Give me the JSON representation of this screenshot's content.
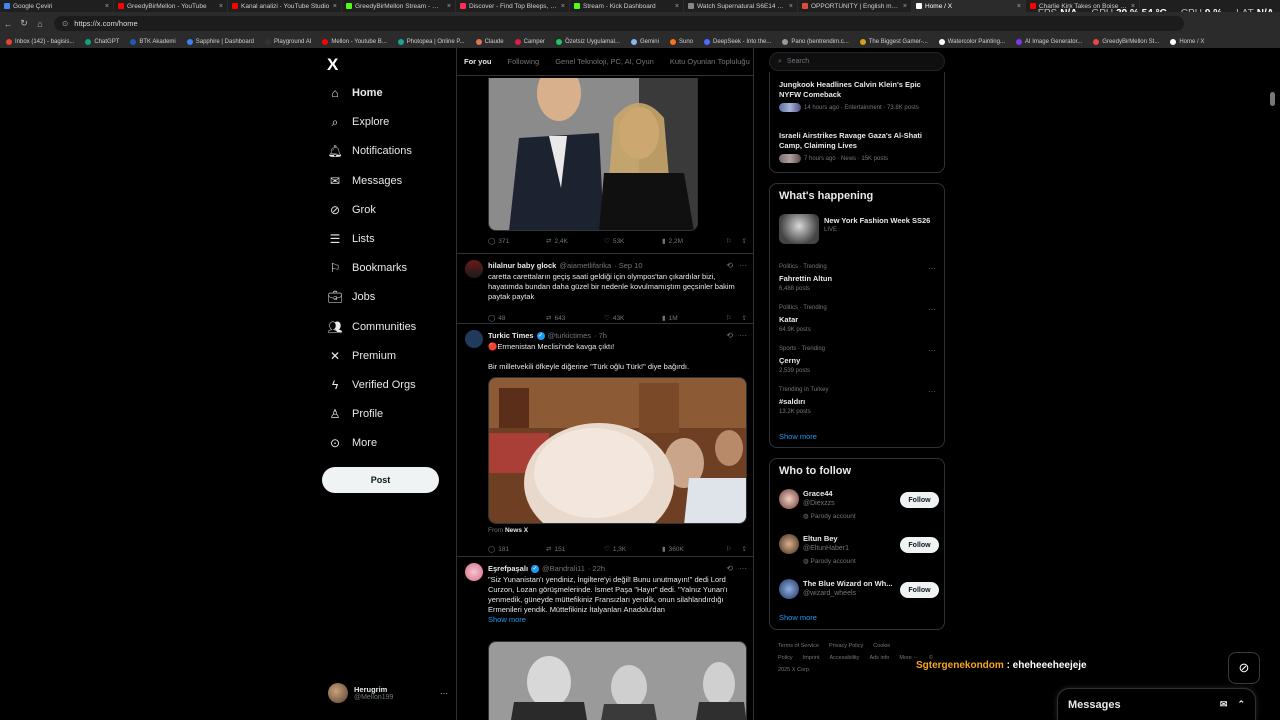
{
  "browser": {
    "tabs": [
      {
        "label": "Google Çeviri",
        "color": "#4285f4"
      },
      {
        "label": "GreedyBirMellon - YouTube",
        "color": "#ff0000"
      },
      {
        "label": "Kanal analizi - YouTube Studio",
        "color": "#ff0000"
      },
      {
        "label": "GreedyBirMellon Stream - Watc",
        "color": "#53fc18"
      },
      {
        "label": "Discover - Find Top Bleeps, Stre",
        "color": "#ff2d55"
      },
      {
        "label": "Stream - Kick Dashboard",
        "color": "#53fc18"
      },
      {
        "label": "Watch Supernatural S6E14 onlin",
        "color": "#888888"
      },
      {
        "label": "OPPORTUNITY | English meanin",
        "color": "#e04a3a"
      },
      {
        "label": "Home / X",
        "color": "#ffffff"
      },
      {
        "label": "Charlie Kirk Takes on Boise Stat",
        "color": "#ff0000"
      }
    ],
    "url": "https://x.com/home",
    "bookmarks": [
      {
        "label": "Inbox (142) - bagisis...",
        "color": "#ea4335"
      },
      {
        "label": "ChatGPT",
        "color": "#10a37f"
      },
      {
        "label": "BTK Akademi",
        "color": "#1e5bb8"
      },
      {
        "label": "Sapphire | Dashboard",
        "color": "#3b82f6"
      },
      {
        "label": "Playground AI",
        "color": "#333333"
      },
      {
        "label": "Mellon - Youtube B...",
        "color": "#ff0000"
      },
      {
        "label": "Photopea | Online P...",
        "color": "#18a497"
      },
      {
        "label": "Claude",
        "color": "#d97757"
      },
      {
        "label": "Camper",
        "color": "#e11d48"
      },
      {
        "label": "Özetsiz Uygulamal...",
        "color": "#22c55e"
      },
      {
        "label": "Gemini",
        "color": "#8ab4f8"
      },
      {
        "label": "Suno",
        "color": "#f97316"
      },
      {
        "label": "DeepSeek - Into the...",
        "color": "#4d6bfe"
      },
      {
        "label": "Pano (bentrendim.c...",
        "color": "#999999"
      },
      {
        "label": "The Biggest Gamer-...",
        "color": "#d4a017"
      },
      {
        "label": "Watercolor Painting...",
        "color": "#ffffff"
      },
      {
        "label": "AI Image Generator...",
        "color": "#7c3aed"
      },
      {
        "label": "GreedyBirMellon St...",
        "color": "#ef4444"
      },
      {
        "label": "Home / X",
        "color": "#ffffff"
      }
    ],
    "overlay": {
      "fps_label": "FPS",
      "fps": "N/A",
      "gpu_label": "GPU",
      "gpu": "39 %  54 °C",
      "cpu_label": "CPU",
      "cpu": "9 %",
      "lat_label": "LAT",
      "lat": "N/A"
    }
  },
  "nav": {
    "logo": "X",
    "items": [
      {
        "label": "Home",
        "icon": "home-icon"
      },
      {
        "label": "Explore",
        "icon": "search-icon"
      },
      {
        "label": "Notifications",
        "icon": "bell-icon"
      },
      {
        "label": "Messages",
        "icon": "envelope-icon"
      },
      {
        "label": "Grok",
        "icon": "grok-icon"
      },
      {
        "label": "Lists",
        "icon": "list-icon"
      },
      {
        "label": "Bookmarks",
        "icon": "bookmark-icon"
      },
      {
        "label": "Jobs",
        "icon": "briefcase-icon"
      },
      {
        "label": "Communities",
        "icon": "people-icon"
      },
      {
        "label": "Premium",
        "icon": "x-icon"
      },
      {
        "label": "Verified Orgs",
        "icon": "lightning-icon"
      },
      {
        "label": "Profile",
        "icon": "person-icon"
      },
      {
        "label": "More",
        "icon": "more-circle-icon"
      }
    ],
    "post_label": "Post",
    "account": {
      "name": "Herugrim",
      "handle": "@Mellon199",
      "more": "···"
    }
  },
  "feed": {
    "tabs": [
      "For you",
      "Following",
      "Genel Teknoloji, PC, AI, Oyun",
      "Kutu Oyunları Topluluğu"
    ],
    "posts": [
      {
        "stats": {
          "replies": "371",
          "reposts": "2,4K",
          "likes": "53K",
          "views": "2,2M"
        }
      },
      {
        "name": "hilalnur baby glock",
        "handle": "@aiametlifarika",
        "time": "· Sep 10",
        "text": "caretta carettaların geçiş saati geldiği için olympos'tan çıkardılar bizi, hayatımda bundan daha güzel bir nedenle kovulmamıştım geçsinler bakim paytak paytak",
        "stats": {
          "replies": "48",
          "reposts": "643",
          "likes": "43K",
          "views": "1M"
        }
      },
      {
        "name": "Turkic Times",
        "handle": "@turkictimes",
        "time": "· 7h",
        "line1": "🔴Ermenistan Meclisi'nde kavga çıktı!",
        "line2": "Bir milletvekili öfkeyle diğerine \"Türk oğlu Türk!\" diye bağırdı.",
        "from_label": "From",
        "from_source": "News X",
        "stats": {
          "replies": "181",
          "reposts": "151",
          "likes": "1,3K",
          "views": "360K"
        }
      },
      {
        "name": "Eşrefpaşalı",
        "handle": "@Bandrali11",
        "time": "· 22h",
        "text": "\"Siz Yunanistan'ı yendiniz, İngiltere'yi değil! Bunu unutmayın!\" dedi Lord Curzon, Lozan görüşmelerinde. İsmet Paşa \"Hayır\" dedi. \"Yalnız Yunan'ı yenmedik, güneyde müttefikiniz Fransızları yendik, onun silahlandırdığı Ermenileri yendik. Müttefikiniz İtalyanları Anadolu'dan",
        "show_more": "Show more"
      }
    ]
  },
  "right": {
    "search_placeholder": "Search",
    "news": [
      {
        "title": "Jungkook Headlines Calvin Klein's Epic NYFW Comeback",
        "meta": "14 hours ago · Entertainment · 73.8K posts"
      },
      {
        "title": "Israeli Airstrikes Ravage Gaza's Al-Shati Camp, Claiming Lives",
        "meta": "7 hours ago · News · 15K posts"
      }
    ],
    "happening": {
      "title": "What's happening",
      "event": {
        "name": "New York Fashion Week SS26",
        "status": "LIVE"
      },
      "trends": [
        {
          "meta": "Politics · Trending",
          "name": "Fahrettin Altun",
          "posts": "6,488 posts"
        },
        {
          "meta": "Politics · Trending",
          "name": "Katar",
          "posts": "64.9K posts"
        },
        {
          "meta": "Sports · Trending",
          "name": "Çerny",
          "posts": "2,539 posts"
        },
        {
          "meta": "Trending in Turkey",
          "name": "#saldırı",
          "posts": "13.2K posts"
        }
      ],
      "show_more": "Show more"
    },
    "who_to_follow": {
      "title": "Who to follow",
      "users": [
        {
          "name": "Grace44",
          "handle": "@Diexzzs",
          "note": "Parody account",
          "button": "Follow"
        },
        {
          "name": "Eltun Bey",
          "handle": "@EltunHaber1",
          "note": "Parody account",
          "button": "Follow"
        },
        {
          "name": "The Blue Wizard on Wh...",
          "handle": "@wizard_wheels",
          "note": "",
          "button": "Follow"
        }
      ],
      "show_more": "Show more"
    },
    "footer": [
      "Terms of Service",
      "Privacy Policy",
      "Cookie Policy",
      "Imprint",
      "Accessibility",
      "Ads info",
      "More ···",
      "© 2025 X Corp."
    ]
  },
  "chat_overlay": {
    "user": "Sgtergenekondom",
    "message": " : eheheeeheejeje"
  },
  "messages_drawer": {
    "title": "Messages"
  }
}
